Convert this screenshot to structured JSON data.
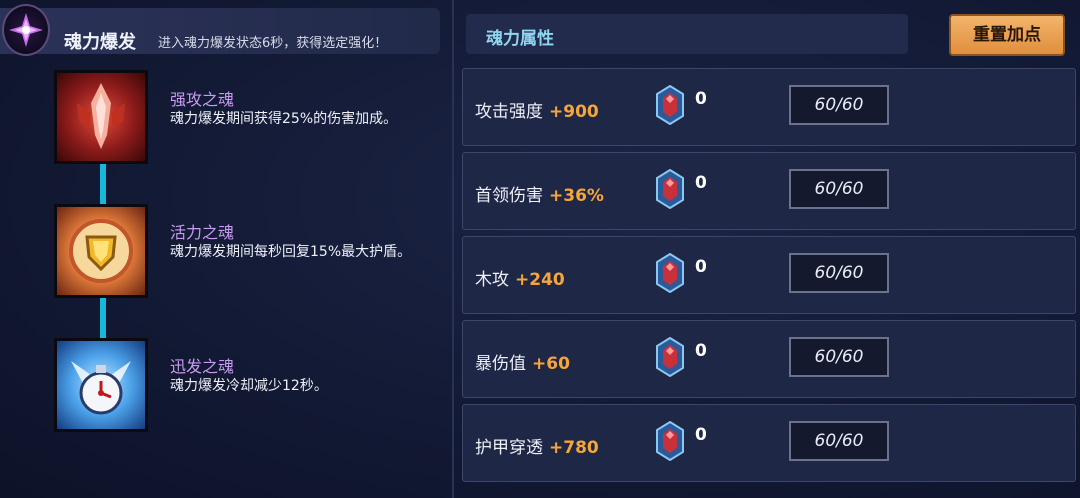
{
  "burst": {
    "title": "魂力爆发",
    "subtitle": "进入魂力爆发状态6秒，获得选定强化！"
  },
  "souls": [
    {
      "name": "强攻之魂",
      "desc": "魂力爆发期间获得25%的伤害加成。",
      "icon": "red-attack-soul-icon"
    },
    {
      "name": "活力之魂",
      "desc": "魂力爆发期间每秒回复15%最大护盾。",
      "icon": "gold-shield-soul-icon"
    },
    {
      "name": "迅发之魂",
      "desc": "魂力爆发冷却减少12秒。",
      "icon": "blue-clock-soul-icon"
    }
  ],
  "attributes": {
    "title": "魂力属性",
    "reset_label": "重置加点",
    "rows": [
      {
        "label": "攻击强度",
        "bonus": "+900",
        "gems": "0",
        "level": "60/60"
      },
      {
        "label": "首领伤害",
        "bonus": "+36%",
        "gems": "0",
        "level": "60/60"
      },
      {
        "label": "木攻",
        "bonus": "+240",
        "gems": "0",
        "level": "60/60"
      },
      {
        "label": "暴伤值",
        "bonus": "+60",
        "gems": "0",
        "level": "60/60"
      },
      {
        "label": "护甲穿透",
        "bonus": "+780",
        "gems": "0",
        "level": "60/60"
      }
    ]
  },
  "colors": {
    "accent_orange": "#f6a53a",
    "soul_name_purple": "#c79cf0",
    "connector_cyan": "#18b8d8",
    "title_cyan": "#8fd6f0"
  }
}
